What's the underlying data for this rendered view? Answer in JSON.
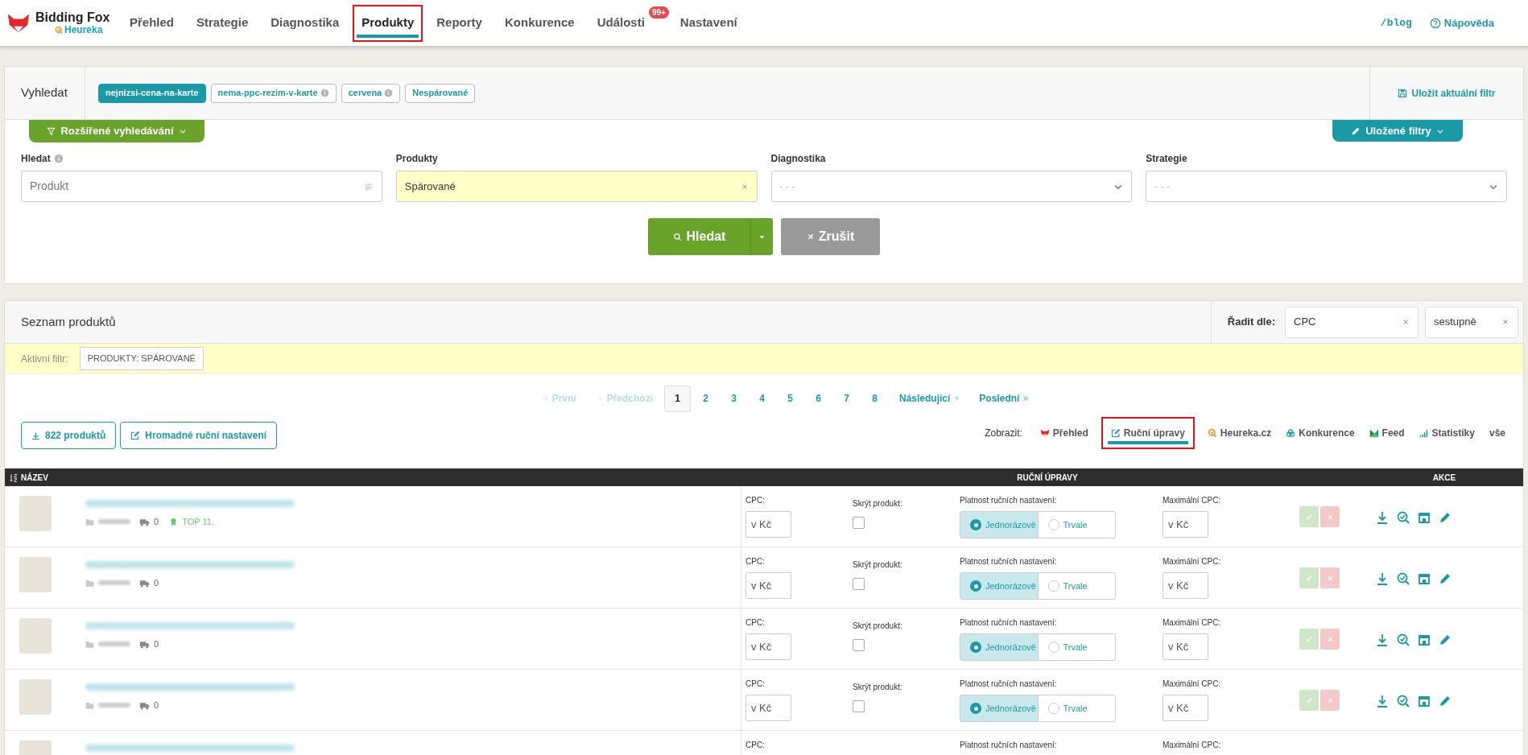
{
  "nav": {
    "brand": "Bidding Fox",
    "sub_brand": "Heureka",
    "tabs": [
      {
        "label": "Přehled",
        "selected": false,
        "highlighted": false
      },
      {
        "label": "Strategie",
        "selected": false,
        "highlighted": false
      },
      {
        "label": "Diagnostika",
        "selected": false,
        "highlighted": false
      },
      {
        "label": "Produkty",
        "selected": true,
        "highlighted": true
      },
      {
        "label": "Reporty",
        "selected": false,
        "highlighted": false
      },
      {
        "label": "Konkurence",
        "selected": false,
        "highlighted": false
      },
      {
        "label": "Události",
        "selected": false,
        "highlighted": false,
        "badge": "99+"
      },
      {
        "label": "Nastavení",
        "selected": false,
        "highlighted": false
      }
    ],
    "blog_link": "/blog",
    "help_link": "Nápověda"
  },
  "search": {
    "title": "Vyhledat",
    "quick_filters": [
      {
        "label": "nejnizsi-cena-na-karte",
        "selected": true,
        "info": false
      },
      {
        "label": "nema-ppc-rezim-v-karte",
        "selected": false,
        "info": true
      },
      {
        "label": "cervena",
        "selected": false,
        "info": true
      },
      {
        "label": "Nespárované",
        "selected": false,
        "info": false
      }
    ],
    "save_button": "Uložit aktuální filtr",
    "advanced_button": "Rozšířené vyhledávání",
    "saved_filters_button": "Uložené filtry",
    "fields": [
      {
        "kind": "text",
        "label": "Hledat",
        "info": true,
        "placeholder": "Produkt"
      },
      {
        "kind": "tag",
        "label": "Produkty",
        "info": false,
        "value": "Spárované"
      },
      {
        "kind": "select",
        "label": "Diagnostika",
        "info": false,
        "placeholder": "- - -"
      },
      {
        "kind": "select",
        "label": "Strategie",
        "info": false,
        "placeholder": "- - -"
      }
    ],
    "search_button": "Hledat",
    "cancel_button": "Zrušit"
  },
  "list": {
    "title": "Seznam produktů",
    "sort_label": "Řadit dle:",
    "sort_fields": [
      "CPC",
      "sestupně"
    ],
    "active_filter_label": "Aktivní filtr:",
    "active_filter_tags": [
      "PRODUKTY: SPÁROVANÉ"
    ],
    "pagination": {
      "first": "První",
      "previous": "Předchozí",
      "pages": [
        {
          "label": "1",
          "selected": true
        },
        {
          "label": "2",
          "selected": false
        },
        {
          "label": "3",
          "selected": false
        },
        {
          "label": "4",
          "selected": false
        },
        {
          "label": "5",
          "selected": false
        },
        {
          "label": "6",
          "selected": false
        },
        {
          "label": "7",
          "selected": false
        },
        {
          "label": "8",
          "selected": false
        }
      ],
      "next": "Následující",
      "last": "Poslední"
    },
    "export_button": "822 produktů",
    "bulk_button": "Hromadné ruční nastavení",
    "view_label": "Zobrazit:",
    "view_options": [
      {
        "kind": "fox",
        "label": "Přehled",
        "selected": false,
        "highlighted": false
      },
      {
        "kind": "edit",
        "label": "Ruční úpravy",
        "selected": true,
        "highlighted": true
      },
      {
        "kind": "heureka",
        "label": "Heureka.cz",
        "selected": false,
        "highlighted": false
      },
      {
        "kind": "competition",
        "label": "Konkurence",
        "selected": false,
        "highlighted": false
      },
      {
        "kind": "feed",
        "label": "Feed",
        "selected": false,
        "highlighted": false
      },
      {
        "kind": "stats",
        "label": "Statistiky",
        "selected": false,
        "highlighted": false
      },
      {
        "kind": "none",
        "label": "vše",
        "selected": false,
        "highlighted": false
      }
    ]
  },
  "table": {
    "columns": [
      "NÁZEV",
      "RUČNÍ ÚPRAVY",
      "AKCE"
    ],
    "rows": [
      {
        "stock_count": "0",
        "rank": "TOP 11.",
        "cpc_label": "CPC:",
        "cpc_placeholder": "v Kč",
        "hide_label": "Skrýt produkt:",
        "hidden": false,
        "validity_label": "Platnost ručních nastavení:",
        "validity_options": [
          {
            "label": "Jednorázově",
            "selected": true
          },
          {
            "label": "Trvale",
            "selected": false
          }
        ],
        "max_cpc_label": "Maximální CPC:",
        "max_cpc_placeholder": "v Kč"
      },
      {
        "stock_count": "0",
        "cpc_label": "CPC:",
        "cpc_placeholder": "v Kč",
        "hide_label": "Skrýt produkt:",
        "hidden": false,
        "validity_label": "Platnost ručních nastavení:",
        "validity_options": [
          {
            "label": "Jednorázově",
            "selected": true
          },
          {
            "label": "Trvale",
            "selected": false
          }
        ],
        "max_cpc_label": "Maximální CPC:",
        "max_cpc_placeholder": "v Kč"
      },
      {
        "stock_count": "0",
        "cpc_label": "CPC:",
        "cpc_placeholder": "v Kč",
        "hide_label": "Skrýt produkt:",
        "hidden": false,
        "validity_label": "Platnost ručních nastavení:",
        "validity_options": [
          {
            "label": "Jednorázově",
            "selected": true
          },
          {
            "label": "Trvale",
            "selected": false
          }
        ],
        "max_cpc_label": "Maximální CPC:",
        "max_cpc_placeholder": "v Kč"
      },
      {
        "stock_count": "0",
        "cpc_label": "CPC:",
        "cpc_placeholder": "v Kč",
        "hide_label": "Skrýt produkt:",
        "hidden": false,
        "validity_label": "Platnost ručních nastavení:",
        "validity_options": [
          {
            "label": "Jednorázově",
            "selected": true
          },
          {
            "label": "Trvale",
            "selected": false
          }
        ],
        "max_cpc_label": "Maximální CPC:",
        "max_cpc_placeholder": "v Kč"
      },
      {
        "cpc_label": "CPC:",
        "validity_label": "Platnost ručních nastavení:",
        "max_cpc_label": "Maximální CPC:"
      }
    ]
  }
}
